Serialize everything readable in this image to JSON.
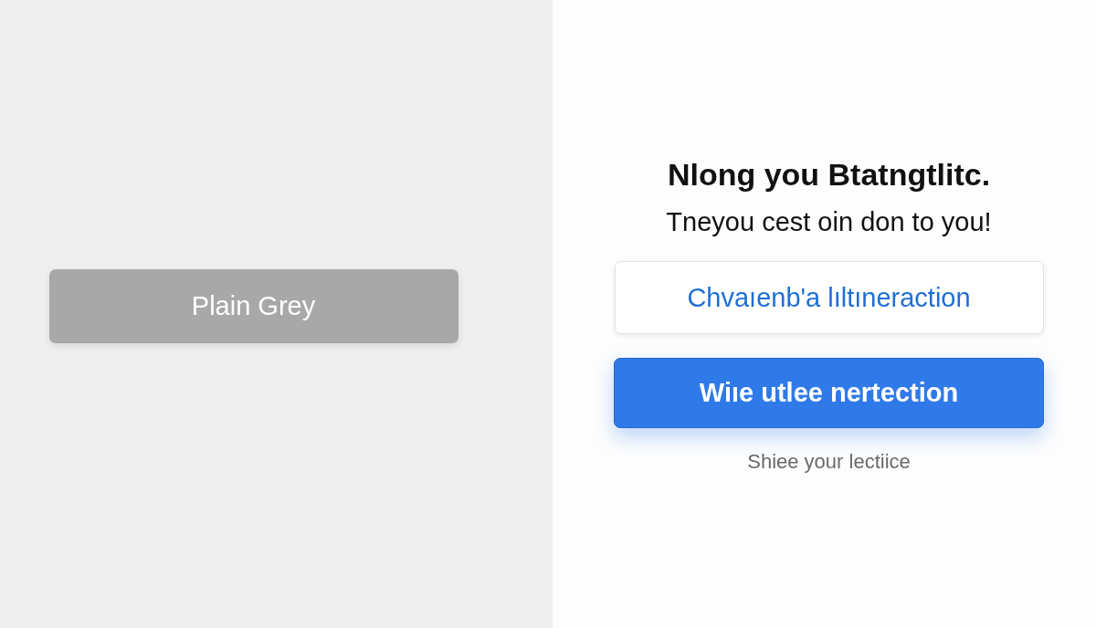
{
  "left_panel": {
    "button": {
      "label": "Plain Grey",
      "kind": "plain"
    }
  },
  "right_panel": {
    "title": "Nlong you Btatngtlitc.",
    "subtitle": "Tneyou cest oin don to you!",
    "buttons": [
      {
        "label": "Chvaıenb'a lıltıneraction",
        "kind": "outline"
      },
      {
        "label": "Wiıe utlee nertection",
        "kind": "primary"
      }
    ],
    "caption": "Shiee your lectiice"
  }
}
